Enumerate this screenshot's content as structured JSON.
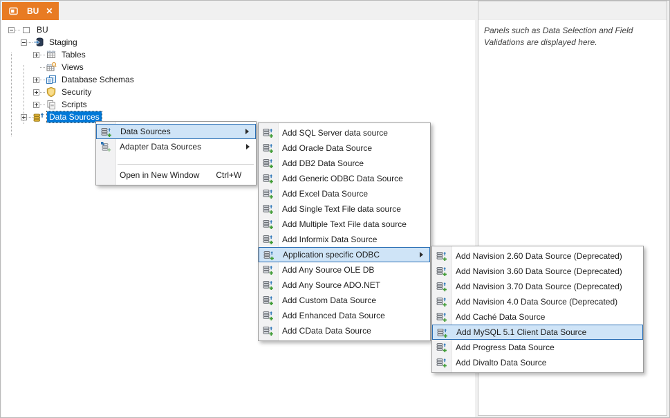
{
  "tab": {
    "icon": "window-icon",
    "label": "BU",
    "close_label": "✕"
  },
  "tree": {
    "items": [
      {
        "label": "BU",
        "level": 1,
        "expand": "minus",
        "icon": "node-icon",
        "selected": false
      },
      {
        "label": "Staging",
        "level": 2,
        "expand": "minus",
        "icon": "staging-icon",
        "selected": false
      },
      {
        "label": "Tables",
        "level": 3,
        "expand": "plus",
        "icon": "tables-icon",
        "selected": false
      },
      {
        "label": "Views",
        "level": 3,
        "expand": null,
        "icon": "views-icon",
        "selected": false
      },
      {
        "label": "Database Schemas",
        "level": 3,
        "expand": "plus",
        "icon": "schemas-icon",
        "selected": false
      },
      {
        "label": "Security",
        "level": 3,
        "expand": "plus",
        "icon": "security-icon",
        "selected": false
      },
      {
        "label": "Scripts",
        "level": 3,
        "expand": "plus",
        "icon": "scripts-icon",
        "selected": false
      },
      {
        "label": "Data Sources",
        "level": 2,
        "expand": "plus",
        "icon": "datasources-icon",
        "selected": true
      }
    ]
  },
  "context_menu": {
    "items": [
      {
        "label": "Data Sources",
        "icon": "add-datasource-icon",
        "submenu": true,
        "highlighted": true
      },
      {
        "label": "Adapter Data Sources",
        "icon": "add-adapter-datasource-icon",
        "submenu": true
      },
      {
        "type": "separator"
      },
      {
        "label": "Open in New Window",
        "icon": "none-icon",
        "shortcut": "Ctrl+W"
      }
    ]
  },
  "datasource_menu": {
    "items": [
      {
        "label": "Add SQL Server data source",
        "icon": "add-datasource-icon"
      },
      {
        "label": "Add Oracle Data Source",
        "icon": "add-datasource-icon"
      },
      {
        "label": "Add DB2 Data Source",
        "icon": "add-datasource-icon"
      },
      {
        "label": "Add Generic ODBC Data Source",
        "icon": "add-datasource-icon"
      },
      {
        "label": "Add Excel Data Source",
        "icon": "add-datasource-icon"
      },
      {
        "label": "Add Single Text File data source",
        "icon": "add-datasource-icon"
      },
      {
        "label": "Add Multiple Text File data source",
        "icon": "add-datasource-icon"
      },
      {
        "label": "Add Informix Data Source",
        "icon": "add-datasource-icon"
      },
      {
        "label": "Application specific ODBC",
        "icon": "add-datasource-icon",
        "submenu": true,
        "highlighted": true
      },
      {
        "label": "Add Any Source OLE DB",
        "icon": "add-datasource-icon"
      },
      {
        "label": "Add Any Source ADO.NET",
        "icon": "add-datasource-icon"
      },
      {
        "label": "Add Custom Data Source",
        "icon": "add-datasource-icon"
      },
      {
        "label": "Add Enhanced Data Source",
        "icon": "add-datasource-icon"
      },
      {
        "label": "Add CData Data Source",
        "icon": "add-datasource-icon"
      }
    ]
  },
  "odbc_menu": {
    "items": [
      {
        "label": "Add Navision 2.60 Data Source (Deprecated)",
        "icon": "add-datasource-icon"
      },
      {
        "label": "Add Navision 3.60 Data Source (Deprecated)",
        "icon": "add-datasource-icon"
      },
      {
        "label": "Add Navision 3.70 Data Source (Deprecated)",
        "icon": "add-datasource-icon"
      },
      {
        "label": "Add Navision 4.0 Data Source (Deprecated)",
        "icon": "add-datasource-icon"
      },
      {
        "label": "Add Caché Data Source",
        "icon": "add-datasource-icon"
      },
      {
        "label": "Add MySQL 5.1 Client Data Source",
        "icon": "add-datasource-icon",
        "highlighted": true
      },
      {
        "label": "Add Progress Data Source",
        "icon": "add-datasource-icon"
      },
      {
        "label": "Add Divalto Data Source",
        "icon": "add-datasource-icon"
      }
    ]
  },
  "side_panel": {
    "text": "Panels such as Data Selection and Field Validations are displayed here."
  },
  "colors": {
    "tab": "#e87b23",
    "tree_selection": "#0078d7",
    "menu_highlight_bg": "#cfe4f7",
    "menu_highlight_border": "#2c70b5"
  }
}
